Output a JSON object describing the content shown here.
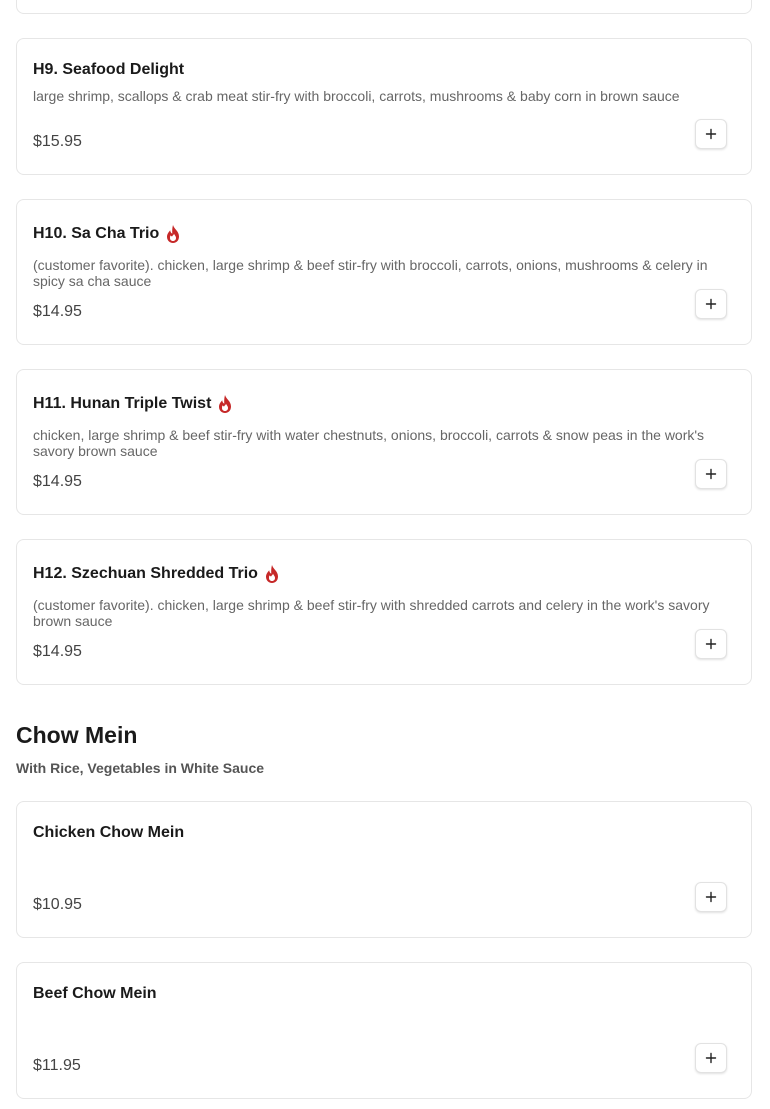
{
  "items_top": [
    {
      "title": "H9. Seafood Delight",
      "spicy": false,
      "description": "large shrimp, scallops & crab meat stir-fry with broccoli, carrots, mushrooms & baby corn in brown sauce",
      "price": "$15.95"
    },
    {
      "title": "H10. Sa Cha Trio",
      "spicy": true,
      "description": "(customer favorite). chicken, large shrimp & beef stir-fry with broccoli, carrots, onions, mushrooms & celery in spicy sa cha sauce",
      "price": "$14.95"
    },
    {
      "title": "H11. Hunan Triple Twist",
      "spicy": true,
      "description": "chicken, large shrimp & beef stir-fry with water chestnuts, onions, broccoli, carrots & snow peas in the work's savory brown sauce",
      "price": "$14.95"
    },
    {
      "title": "H12. Szechuan Shredded Trio",
      "spicy": true,
      "description": "(customer favorite). chicken, large shrimp & beef stir-fry with shredded carrots and celery in the work's savory brown sauce",
      "price": "$14.95"
    }
  ],
  "section": {
    "title": "Chow Mein",
    "subtitle": "With Rice, Vegetables in White Sauce"
  },
  "items_chow_mein": [
    {
      "title": "Chicken Chow Mein",
      "price": "$10.95"
    },
    {
      "title": "Beef Chow Mein",
      "price": "$11.95"
    }
  ],
  "icons": {
    "spicy": "flame-icon",
    "add": "plus-icon"
  },
  "colors": {
    "spicy": "#c62828",
    "border": "#e6e6e6",
    "text": "#1a1a1a",
    "muted": "#666666"
  }
}
